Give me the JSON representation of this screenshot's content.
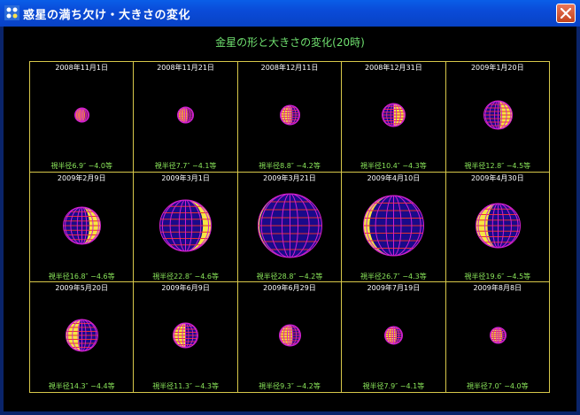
{
  "window": {
    "title": "惑星の満ち欠け・大きさの変化",
    "heading": "金星の形と大きさの変化(20時)"
  },
  "colors": {
    "disk_fill": "#1a0a8a",
    "lit_fill": "#f5e642",
    "grid_line": "#e83030",
    "grid_line_dark": "#d020d0",
    "date_text": "#ffffff",
    "info_text": "#8ae65a",
    "frame": "#d7c84a"
  },
  "cells": [
    {
      "date": "2008年11月1日",
      "info": "視半径6.9″ −4.0等",
      "radius": 8,
      "lit": 0.72,
      "lit_side": "left"
    },
    {
      "date": "2008年11月21日",
      "info": "視半径7.7″ −4.1等",
      "radius": 9,
      "lit": 0.66,
      "lit_side": "left"
    },
    {
      "date": "2008年12月11日",
      "info": "視半径8.8″ −4.2等",
      "radius": 11,
      "lit": 0.58,
      "lit_side": "left"
    },
    {
      "date": "2008年12月31日",
      "info": "視半径10.4″ −4.3等",
      "radius": 13,
      "lit": 0.52,
      "lit_side": "right"
    },
    {
      "date": "2009年1月20日",
      "info": "視半径12.8″ −4.5等",
      "radius": 16,
      "lit": 0.42,
      "lit_side": "right"
    },
    {
      "date": "2009年2月9日",
      "info": "視半径16.8″ −4.6等",
      "radius": 21,
      "lit": 0.3,
      "lit_side": "right"
    },
    {
      "date": "2009年3月1日",
      "info": "視半径22.8″ −4.6等",
      "radius": 29,
      "lit": 0.16,
      "lit_side": "right"
    },
    {
      "date": "2009年3月21日",
      "info": "視半径28.8″ −4.2等",
      "radius": 36,
      "lit": 0.02,
      "lit_side": "left"
    },
    {
      "date": "2009年4月10日",
      "info": "視半径26.7″ −4.3等",
      "radius": 34,
      "lit": 0.1,
      "lit_side": "left"
    },
    {
      "date": "2009年4月30日",
      "info": "視半径19.6″ −4.5等",
      "radius": 25,
      "lit": 0.26,
      "lit_side": "left"
    },
    {
      "date": "2009年5月20日",
      "info": "視半径14.3″ −4.4等",
      "radius": 18,
      "lit": 0.4,
      "lit_side": "left"
    },
    {
      "date": "2009年6月9日",
      "info": "視半径11.3″ −4.3等",
      "radius": 14,
      "lit": 0.52,
      "lit_side": "left"
    },
    {
      "date": "2009年6月29日",
      "info": "視半径9.3″ −4.2等",
      "radius": 12,
      "lit": 0.6,
      "lit_side": "left"
    },
    {
      "date": "2009年7月19日",
      "info": "視半径7.9″ −4.1等",
      "radius": 10,
      "lit": 0.68,
      "lit_side": "left"
    },
    {
      "date": "2009年8月8日",
      "info": "視半径7.0″ −4.0等",
      "radius": 9,
      "lit": 0.75,
      "lit_side": "left"
    }
  ]
}
